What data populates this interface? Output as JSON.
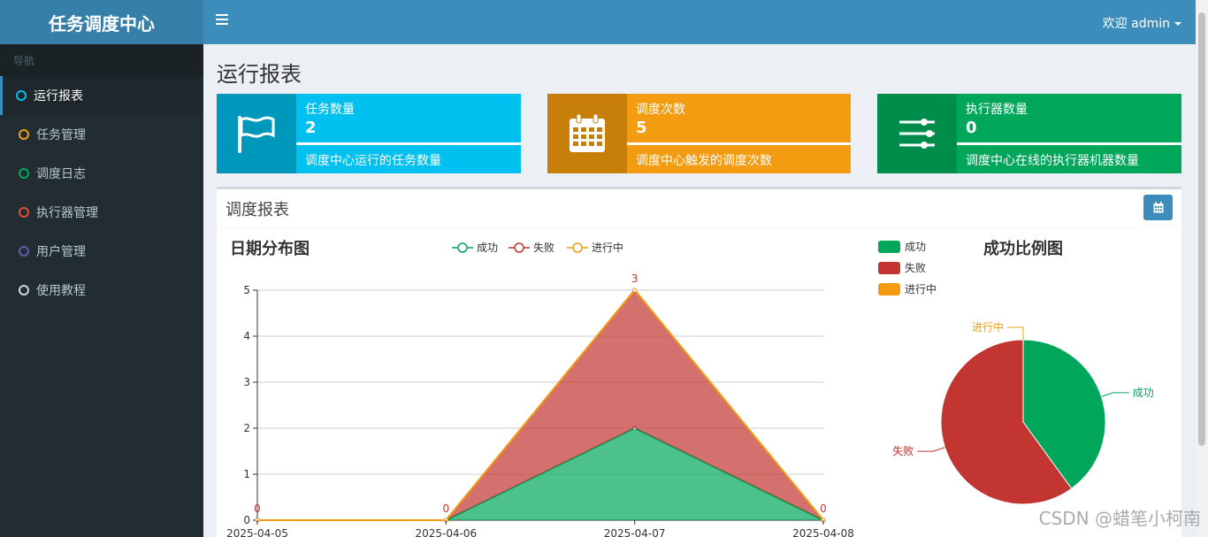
{
  "app": {
    "title": "任务调度中心"
  },
  "topbar": {
    "welcome": "欢迎 admin"
  },
  "sidebar": {
    "header": "导航",
    "items": [
      {
        "label": "运行报表",
        "color": "#00c0ef",
        "active": true
      },
      {
        "label": "任务管理",
        "color": "#f39c12"
      },
      {
        "label": "调度日志",
        "color": "#00a65a"
      },
      {
        "label": "执行器管理",
        "color": "#dd4b39"
      },
      {
        "label": "用户管理",
        "color": "#605ca8"
      },
      {
        "label": "使用教程",
        "color": "#d2d6de"
      }
    ]
  },
  "page": {
    "title": "运行报表"
  },
  "info_boxes": [
    {
      "title": "任务数量",
      "value": "2",
      "desc": "调度中心运行的任务数量",
      "icon": "flag-icon",
      "bg": "#00c0ef",
      "icon_bg": "#0097bc"
    },
    {
      "title": "调度次数",
      "value": "5",
      "desc": "调度中心触发的调度次数",
      "icon": "calendar-icon",
      "bg": "#f39c12",
      "icon_bg": "#c87f0a"
    },
    {
      "title": "执行器数量",
      "value": "0",
      "desc": "调度中心在线的执行器机器数量",
      "icon": "sliders-icon",
      "bg": "#00a65a",
      "icon_bg": "#008d4c"
    }
  ],
  "report": {
    "title": "调度报表"
  },
  "line_chart_title": "日期分布图",
  "pie_chart_title": "成功比例图",
  "chart_data": [
    {
      "type": "area",
      "title": "日期分布图",
      "categories": [
        "2025-04-05",
        "2025-04-06",
        "2025-04-07",
        "2025-04-08"
      ],
      "ylim": [
        0,
        5
      ],
      "yticks": [
        "0",
        "1",
        "2",
        "3",
        "4",
        "5"
      ],
      "legend": [
        "成功",
        "失败",
        "进行中"
      ],
      "series": [
        {
          "name": "成功",
          "values": [
            0,
            0,
            2,
            0
          ],
          "color": "#00a65a"
        },
        {
          "name": "失败",
          "values": [
            0,
            0,
            3,
            0
          ],
          "color": "#c23531"
        },
        {
          "name": "进行中",
          "values": [
            0,
            0,
            0,
            0
          ],
          "color": "#f39c12"
        }
      ],
      "data_labels": [
        "0",
        "0",
        "3",
        "0"
      ],
      "stacked": true
    },
    {
      "type": "pie",
      "title": "成功比例图",
      "legend": [
        "成功",
        "失败",
        "进行中"
      ],
      "slices": [
        {
          "name": "成功",
          "value": 2,
          "color": "#00a65a"
        },
        {
          "name": "失败",
          "value": 3,
          "color": "#c23531"
        },
        {
          "name": "进行中",
          "value": 0,
          "color": "#f39c12"
        }
      ]
    }
  ],
  "watermark": "CSDN @蜡笔小柯南"
}
